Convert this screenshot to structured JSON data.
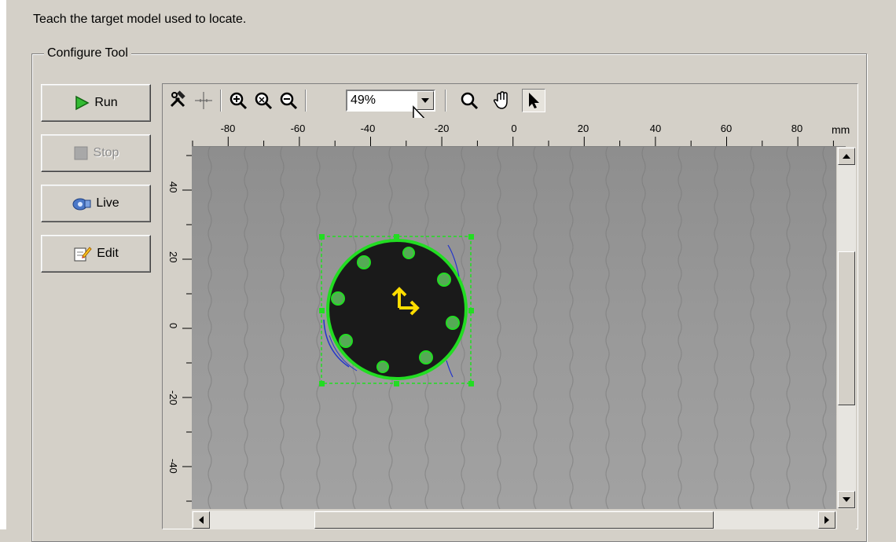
{
  "instruction": "Teach the target model used to locate.",
  "group": {
    "label": "Configure Tool"
  },
  "buttons": {
    "run": "Run",
    "stop": "Stop",
    "live": "Live",
    "edit": "Edit"
  },
  "toolbar": {
    "zoom_value": "49%",
    "icons": [
      "wrench-hammer-icon",
      "crosshair-icon",
      "zoom-in-icon",
      "zoom-fit-icon",
      "zoom-out-icon",
      "magnifier-icon",
      "pan-hand-icon",
      "pointer-arrow-icon"
    ]
  },
  "ruler": {
    "unit": "mm",
    "h_ticks": [
      "-80",
      "-60",
      "-40",
      "-20",
      "0",
      "20",
      "40",
      "60",
      "80"
    ],
    "v_ticks": [
      "40",
      "20",
      "0",
      "-20",
      "-40"
    ]
  },
  "colors": {
    "model_outline": "#22dd22",
    "origin_marker": "#ffdd00",
    "run_icon": "#22aa22"
  }
}
